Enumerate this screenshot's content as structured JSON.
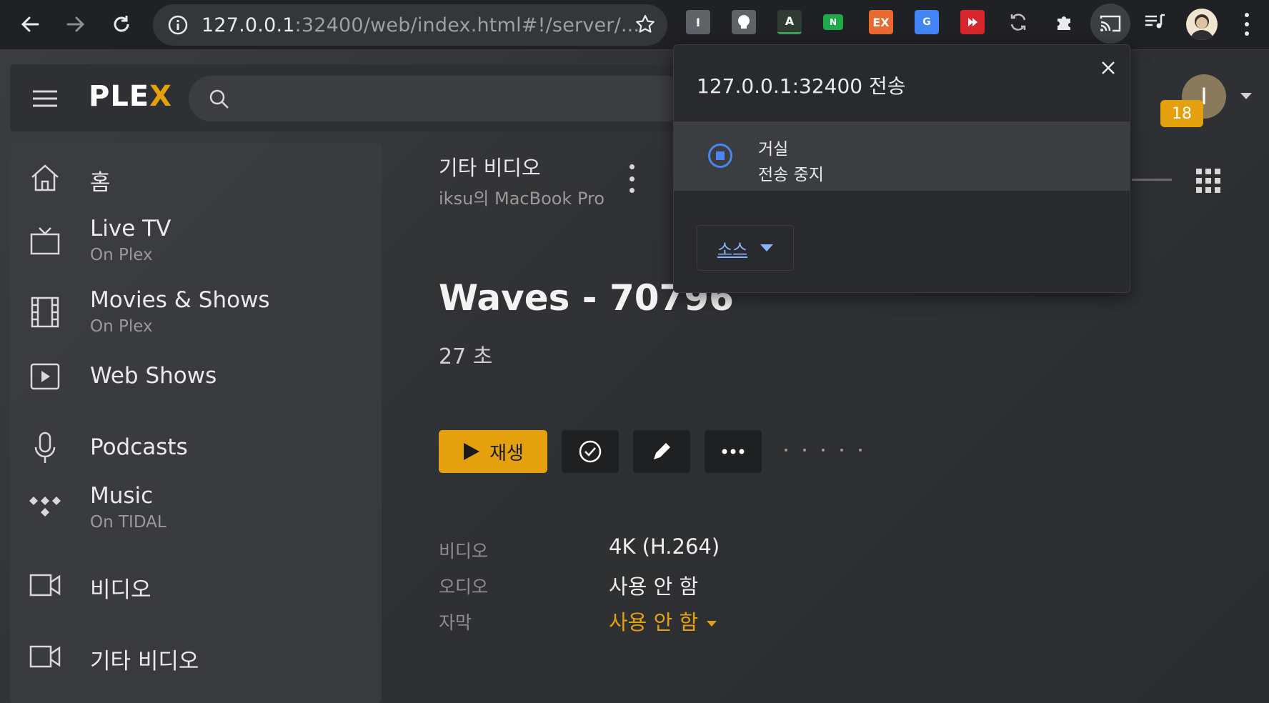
{
  "browser": {
    "url_host": "127.0.0.1",
    "url_rest": ":32400/web/index.html#!/server/...",
    "extensions": [
      {
        "name": "i-extension",
        "label": "I"
      },
      {
        "name": "bulb-extension",
        "label": ""
      },
      {
        "name": "font-extension",
        "label": "A"
      },
      {
        "name": "n-extension",
        "label": "N"
      },
      {
        "name": "ex-extension",
        "label": "EX"
      },
      {
        "name": "translate-extension",
        "label": "G"
      },
      {
        "name": "red-play-extension",
        "label": ""
      }
    ]
  },
  "plex": {
    "logo_text": "PLE",
    "logo_x": "X",
    "user_initial": "I",
    "notification_count": "18",
    "sidebar": [
      {
        "label": "홈",
        "sub": "",
        "icon": "home-icon"
      },
      {
        "label": "Live TV",
        "sub": "On Plex",
        "icon": "tv-icon"
      },
      {
        "label": "Movies & Shows",
        "sub": "On Plex",
        "icon": "film-icon"
      },
      {
        "label": "Web Shows",
        "sub": "",
        "icon": "play-square-icon"
      },
      {
        "label": "Podcasts",
        "sub": "",
        "icon": "microphone-icon"
      },
      {
        "label": "Music",
        "sub": "On TIDAL",
        "icon": "tidal-icon"
      },
      {
        "label": "비디오",
        "sub": "",
        "icon": "video-camera-icon"
      },
      {
        "label": "기타 비디오",
        "sub": "",
        "icon": "video-camera-icon"
      }
    ],
    "library": {
      "title": "기타 비디오",
      "server": "iksu의 MacBook Pro"
    },
    "item": {
      "title": "Waves - 70796",
      "duration": "27 초",
      "play_label": "재생",
      "details": [
        {
          "label": "비디오",
          "value": "4K (H.264)"
        },
        {
          "label": "오디오",
          "value": "사용 안 함"
        },
        {
          "label": "자막",
          "value": "사용 안 함"
        }
      ]
    }
  },
  "cast": {
    "title": "127.0.0.1:32400 전송",
    "device": "거실",
    "status": "전송 중지",
    "source_label": "소스"
  },
  "colors": {
    "plex_accent": "#e5a00d",
    "cast_blue": "#4a86f0"
  }
}
